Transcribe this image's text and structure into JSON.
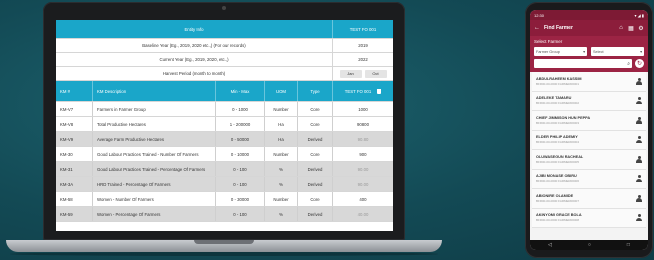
{
  "colors": {
    "teal_header": "#1aa6c9",
    "maroon": "#8c1d3b",
    "background": "#134a55"
  },
  "laptop": {
    "info_header": {
      "title": "Entity Info",
      "value": "TEST FO 001"
    },
    "info_rows": [
      {
        "label": "Baseline Year (Eg., 2019, 2020 etc.,) (For our records)",
        "value": "2019"
      },
      {
        "label": "Current Year (Eg., 2019, 2020, etc.,)",
        "value": "2022"
      }
    ],
    "harvest": {
      "label": "Harvest Period (month to month)",
      "from": "Jan",
      "to": "Oct"
    },
    "grid_header": {
      "id": "KM #",
      "desc": "KM Description",
      "min_max": "Min - Max",
      "uom": "UOM",
      "type": "Type",
      "value": "TEST FO 001"
    },
    "grid_rows": [
      {
        "id": "KM-V7",
        "desc": "Farmers in Farmer Group",
        "min_max": "0 - 1000",
        "uom": "Number",
        "type": "Core",
        "value": "1000",
        "shade": "white",
        "muted": false
      },
      {
        "id": "KM-V8",
        "desc": "Total Productive Hectares",
        "min_max": "1 - 200000",
        "uom": "Ha",
        "type": "Core",
        "value": "90800",
        "shade": "white",
        "muted": false
      },
      {
        "id": "KM-V9",
        "desc": "Average Farm Productive Hectares",
        "min_max": "0 - 50000",
        "uom": "Ha",
        "type": "Derived",
        "value": "90.80",
        "shade": "gray",
        "muted": true
      },
      {
        "id": "KM-30",
        "desc": "Good Labour Practices Trained - Number Of Farmers",
        "min_max": "0 - 10000",
        "uom": "Number",
        "type": "Core",
        "value": "900",
        "shade": "white",
        "muted": false
      },
      {
        "id": "KM-31",
        "desc": "Good Labour Practices Trained - Percentage Of Farmers",
        "min_max": "0 - 100",
        "uom": "%",
        "type": "Derived",
        "value": "90.00",
        "shade": "gray",
        "muted": true
      },
      {
        "id": "KM-3A",
        "desc": "HRD Trained - Percentage Of Farmers",
        "min_max": "0 - 100",
        "uom": "%",
        "type": "Derived",
        "value": "90.00",
        "shade": "gray",
        "muted": true
      },
      {
        "id": "KM-58",
        "desc": "Women - Number Of Farmers",
        "min_max": "0 - 30000",
        "uom": "Number",
        "type": "Core",
        "value": "400",
        "shade": "white",
        "muted": false
      },
      {
        "id": "KM-59",
        "desc": "Women - Percentage Of Farmers",
        "min_max": "0 - 100",
        "uom": "%",
        "type": "Derived",
        "value": "40.00",
        "shade": "gray",
        "muted": true
      }
    ]
  },
  "phone": {
    "status": {
      "time": "12:30",
      "icons": "▾ ◢ ▮"
    },
    "title": "Find Farmer",
    "filter_label": "Select Farmer",
    "select_group": "Farmer Group",
    "select_second": "Select",
    "farmers": [
      {
        "name": "ABDULRAHEEM KASSIM",
        "id": "BFR00-00-0000 FARMER00001"
      },
      {
        "name": "ADELEKE TAMARU",
        "id": "BFR00-00-0000 FARMER00002"
      },
      {
        "name": "CHIEF JIMMISON HUN PEPPA",
        "id": "BFR00-00-0000 FARMER00003"
      },
      {
        "name": "ELDER PHILIP ADEMIY",
        "id": "BFR00-00-0000 FARMER00004"
      },
      {
        "name": "OLUWASEGUN RACHEAL",
        "id": "BFR00-00-0000 FARMER00005"
      },
      {
        "name": "AJIBI MONASE OBIRU",
        "id": "BFR00-00-0000 FARMER00006"
      },
      {
        "name": "ABIONIRE OLAMIDE",
        "id": "BFR00-00-0000 FARMER00007"
      },
      {
        "name": "AKINYOMI GRACE BOLA",
        "id": "BFR00-00-0000 FARMER00008"
      }
    ],
    "nav": {
      "back": "◁",
      "home": "○",
      "recent": "□"
    }
  }
}
